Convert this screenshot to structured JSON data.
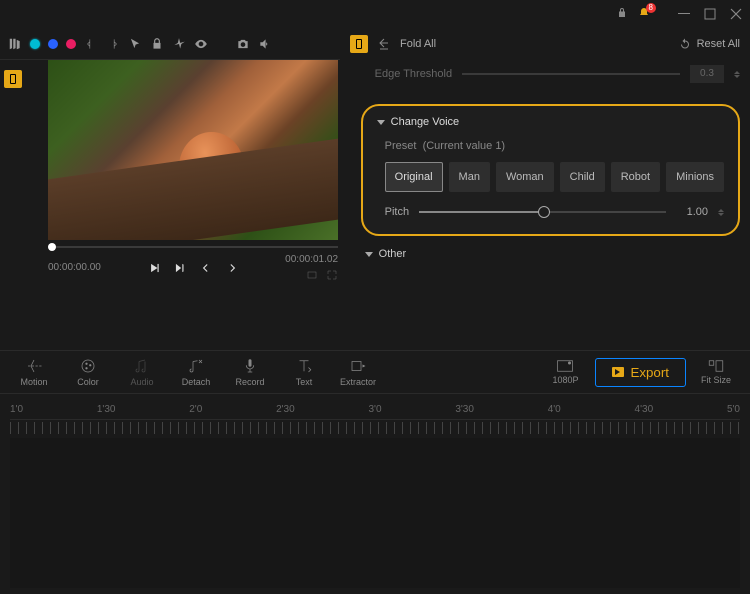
{
  "titlebar": {
    "notification_count": "8"
  },
  "toolbar": {
    "fold_all": "Fold All",
    "reset_all": "Reset All"
  },
  "edge_threshold": {
    "label": "Edge Threshold",
    "value": "0.3"
  },
  "change_voice": {
    "title": "Change Voice",
    "preset_label": "Preset",
    "preset_current": "(Current value 1)",
    "presets": [
      "Original",
      "Man",
      "Woman",
      "Child",
      "Robot",
      "Minions"
    ],
    "selected_preset": "Original",
    "pitch_label": "Pitch",
    "pitch_value": "1.00"
  },
  "other": {
    "label": "Other"
  },
  "preview": {
    "time_start": "00:00:00.00",
    "time_end": "00:00:01.02"
  },
  "bottom_toolbar": {
    "motion": "Motion",
    "color": "Color",
    "audio": "Audio",
    "detach": "Detach",
    "record": "Record",
    "text": "Text",
    "extractor": "Extractor",
    "quality": "1080P",
    "export": "Export",
    "fit_size": "Fit Size"
  },
  "timeline_marks": [
    "1'0",
    "1'30",
    "2'0",
    "2'30",
    "3'0",
    "3'30",
    "4'0",
    "4'30",
    "5'0"
  ]
}
